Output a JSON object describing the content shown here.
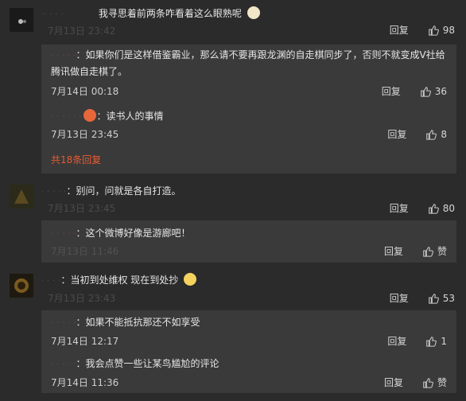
{
  "c1": {
    "username": "·· · · ·",
    "text": "我寻思着前两条咋看着这么眼熟呢",
    "time": "7月13日 23:42",
    "reply": "回复",
    "likes": "98",
    "subs": [
      {
        "username": "· · · · ·",
        "text": "：如果你们是这样借鉴霸业，那么请不要再跟龙渊的自走棋同步了，否则不就变成V社给腾讯做自走棋了。",
        "time": "7月14日 00:18",
        "reply": "回复",
        "likes": "36"
      },
      {
        "username": "· · · · · ·",
        "text": "：读书人的事情",
        "time": "7月13日 23:45",
        "reply": "回复",
        "likes": "8"
      }
    ],
    "more": "共18条回复"
  },
  "c2": {
    "username": "· · · · ·",
    "text": "：别问，问就是各自打造。",
    "time": "7月13日 23:45",
    "reply": "回复",
    "likes": "80",
    "subs": [
      {
        "username": "· · · · ·",
        "text": "：这个微博好像是游廊吧！",
        "time": "7月13日 11:46",
        "reply": "回复",
        "likes": "赞"
      }
    ]
  },
  "c3": {
    "username": "· · · ·",
    "text": "：当初到处维权 现在到处抄",
    "time": "7月13日 23:43",
    "reply": "回复",
    "likes": "53",
    "subs": [
      {
        "username": "· · · · ·",
        "text": "：如果不能抵抗那还不如享受",
        "time": "7月14日 12:17",
        "reply": "回复",
        "likes": "1"
      },
      {
        "username": "· · · · ·",
        "text": "：我会点赞一些让某鸟尴尬的评论",
        "time": "7月14日 11:36",
        "reply": "回复",
        "likes": "赞"
      }
    ]
  }
}
